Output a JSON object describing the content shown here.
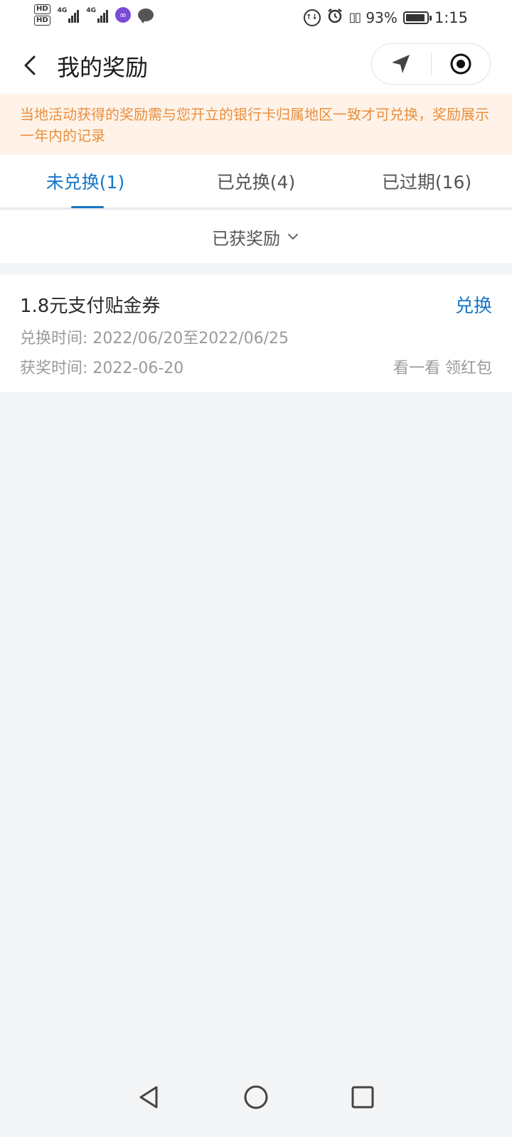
{
  "status_bar": {
    "hd1": "HD",
    "hd2": "HD",
    "signal1_label": "4G",
    "signal2_label": "4G",
    "battery_percent": "93%",
    "battery_level": 0.93,
    "time": "1:15",
    "icons": [
      "hd-icon",
      "signal-icon",
      "app-notification-icon",
      "message-icon",
      "data-saver-icon",
      "alarm-icon",
      "vibrate-icon",
      "battery-icon"
    ]
  },
  "nav": {
    "title": "我的奖励",
    "back_icon": "chevron-left-icon",
    "capsule_icons": [
      "location-arrow-icon",
      "target-circle-icon"
    ]
  },
  "notice": {
    "text": "当地活动获得的奖励需与您开立的银行卡归属地区一致才可兑换，奖励展示一年内的记录"
  },
  "tabs": [
    {
      "label": "未兑换(1)",
      "active": true
    },
    {
      "label": "已兑换(4)",
      "active": false
    },
    {
      "label": "已过期(16)",
      "active": false
    }
  ],
  "filter": {
    "label": "已获奖励",
    "icon": "chevron-down-icon"
  },
  "rewards": [
    {
      "title": "1.8元支付贴金券",
      "action": "兑换",
      "redeem_period": "兑换时间: 2022/06/20至2022/06/25",
      "award_time": "获奖时间: 2022-06-20",
      "link": "看一看 领红包"
    }
  ],
  "colors": {
    "accent": "#1677c8",
    "notice_bg": "#fff3e9",
    "notice_text": "#e98f3e",
    "page_bg": "#f3f4f6"
  }
}
